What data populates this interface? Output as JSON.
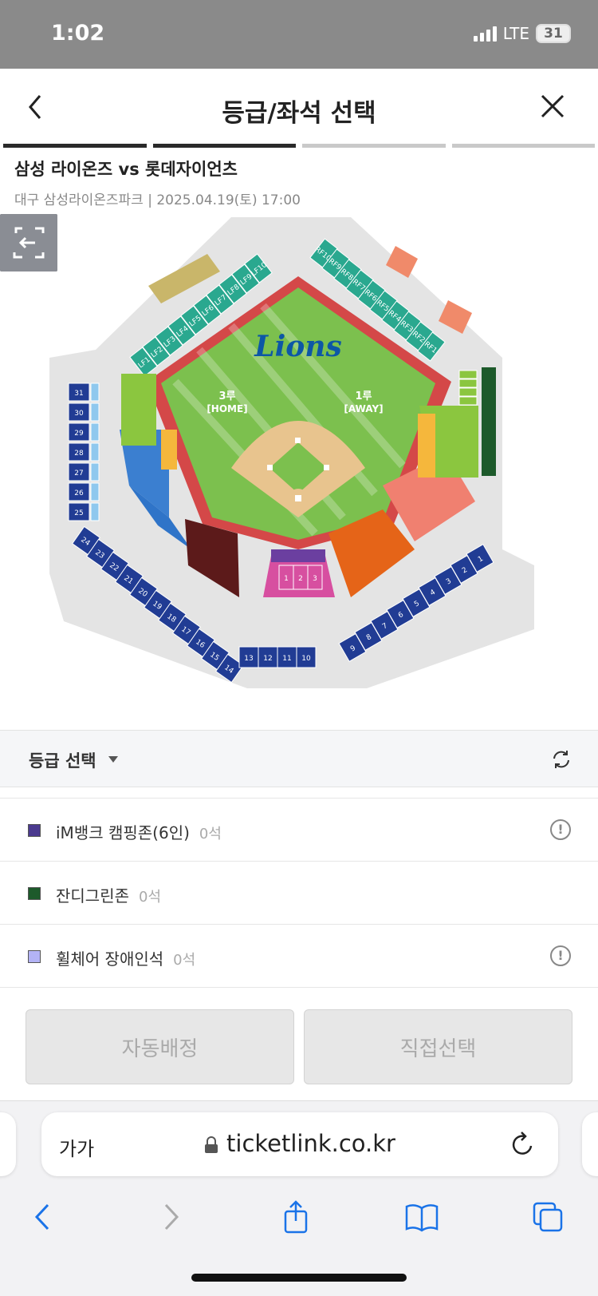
{
  "status": {
    "time": "1:02",
    "network": "LTE",
    "battery": "31"
  },
  "header": {
    "title": "등급/좌석 선택"
  },
  "steps": [
    {
      "active": true
    },
    {
      "active": true
    },
    {
      "active": false
    },
    {
      "active": false
    }
  ],
  "event": {
    "title": "삼성 라이온즈 vs 롯데자이언츠",
    "venue_datetime": "대구 삼성라이온즈파크 | 2025.04.19(토) 17:00"
  },
  "map": {
    "logo": "Lions",
    "third_base_label": "3루",
    "third_base_sub": "[HOME]",
    "first_base_label": "1루",
    "first_base_sub": "[AWAY]",
    "left_field_sections": [
      "LF1",
      "LF2",
      "LF3",
      "LF4",
      "LF5",
      "LF6",
      "LF7",
      "LF8",
      "LF9",
      "LF10"
    ],
    "right_field_sections": [
      "RF10",
      "RF9",
      "RF8",
      "RF7",
      "RF6",
      "RF5",
      "RF4",
      "RF3",
      "RF2",
      "RF1"
    ],
    "third_base_blue_rows": [
      "31",
      "30",
      "29",
      "28",
      "27",
      "26",
      "25"
    ],
    "home_plate_sections": [
      "1",
      "2",
      "3"
    ],
    "lower_sections": [
      "24",
      "23",
      "22",
      "21",
      "20",
      "19",
      "18",
      "17",
      "16",
      "15",
      "14",
      "13",
      "12",
      "11",
      "10",
      "9",
      "8",
      "7",
      "6",
      "5",
      "4",
      "3",
      "2",
      "1"
    ],
    "first_base_outfield_rows": [
      "12",
      "11",
      "10",
      "9",
      "8",
      "7",
      "6",
      "5",
      "4",
      "3",
      "2",
      "1"
    ],
    "colors": {
      "field": "#7cc04e",
      "infield": "#e8c48e",
      "track": "#d44848",
      "concourse": "#e4e4e4",
      "navy": "#213c94",
      "teal": "#2aa88f",
      "orange": "#e56418",
      "pink": "#d74fa0",
      "maroon": "#5c1a1a",
      "purple": "#6b3fa0",
      "yellow_green": "#8bc63f",
      "sky": "#8fc8ee",
      "salmon": "#f08070",
      "brand": "#0d57a6"
    }
  },
  "grade": {
    "title": "등급 선택",
    "items": [
      {
        "name": "iM뱅크 캠핑존(6인)",
        "count": "0석",
        "color": "#4b3a8f",
        "info": true
      },
      {
        "name": "잔디그린존",
        "count": "0석",
        "color": "#1d5a2b",
        "info": false
      },
      {
        "name": "휠체어 장애인석",
        "count": "0석",
        "color": "#b3b3f5",
        "info": true
      }
    ]
  },
  "actions": {
    "auto": "자동배정",
    "manual": "직접선택"
  },
  "browser": {
    "font_size": "가가",
    "url": "ticketlink.co.kr"
  }
}
